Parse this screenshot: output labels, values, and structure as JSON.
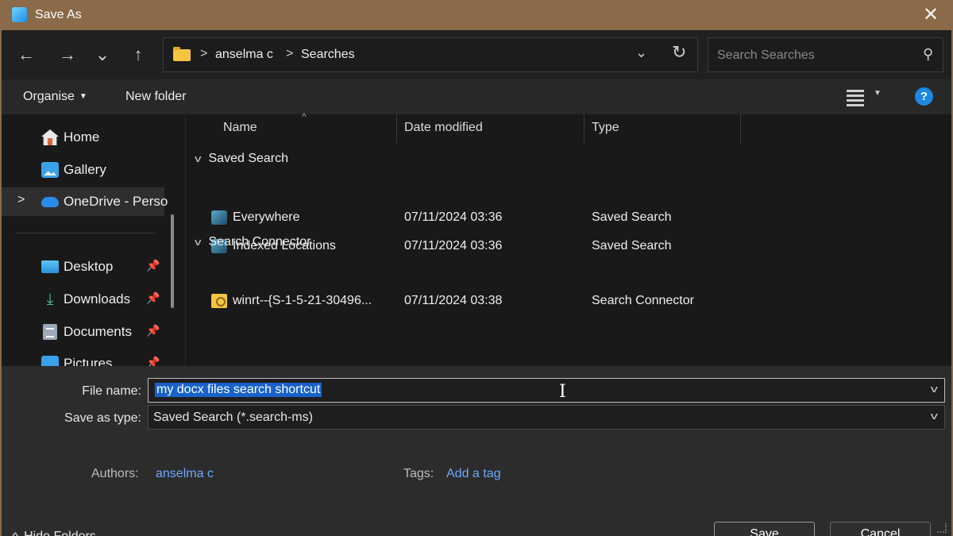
{
  "window": {
    "title": "Save As",
    "close": "✕"
  },
  "nav": {
    "back": "←",
    "forward": "→",
    "recent": "⌄",
    "up": "↑"
  },
  "address": {
    "segments": [
      "anselma c",
      "Searches"
    ],
    "separator": ">",
    "dropdown": "⌄",
    "refresh": "↻"
  },
  "search": {
    "placeholder": "Search Searches",
    "icon": "⚲"
  },
  "toolbar": {
    "organise": "Organise",
    "new_folder": "New folder",
    "help": "?"
  },
  "sidebar": {
    "items": [
      {
        "label": "Home",
        "icon": "home-icon"
      },
      {
        "label": "Gallery",
        "icon": "gallery-icon"
      },
      {
        "label": "OneDrive - Perso",
        "icon": "onedrive-icon",
        "expand": ">"
      },
      {
        "label": "Desktop",
        "icon": "desktop-icon",
        "pin": "📌"
      },
      {
        "label": "Downloads",
        "icon": "downloads-icon",
        "pin": "📌",
        "glyph": "⤓"
      },
      {
        "label": "Documents",
        "icon": "documents-icon",
        "pin": "📌"
      },
      {
        "label": "Pictures",
        "icon": "pictures-icon",
        "pin": "📌"
      }
    ]
  },
  "filelist": {
    "columns": {
      "name": "Name",
      "date": "Date modified",
      "type": "Type",
      "sort_glyph": "^"
    },
    "groups": [
      {
        "label": "Saved Search",
        "chevron": "v",
        "rows": [
          {
            "name": "Everywhere",
            "date": "07/11/2024 03:36",
            "type": "Saved Search"
          },
          {
            "name": "Indexed Locations",
            "date": "07/11/2024 03:36",
            "type": "Saved Search"
          }
        ]
      },
      {
        "label": "Search Connector",
        "chevron": "v",
        "rows": [
          {
            "name": "winrt--{S-1-5-21-30496...",
            "date": "07/11/2024 03:38",
            "type": "Search Connector"
          }
        ]
      }
    ]
  },
  "form": {
    "file_name_label": "File name:",
    "file_name_value": "my docx files search shortcut",
    "save_type_label": "Save as type:",
    "save_type_value": "Saved Search (*.search-ms)",
    "dropdown": "v",
    "cursor": "I",
    "authors_label": "Authors:",
    "authors_value": "anselma c",
    "tags_label": "Tags:",
    "tags_value": "Add a tag"
  },
  "footer": {
    "hide_folders": "Hide Folders",
    "hide_chevron": "^",
    "save": "Save",
    "cancel": "Cancel"
  },
  "colors": {
    "accent": "#1c86e0",
    "selection": "#1862c9",
    "link": "#6ea8ff",
    "title_bar": "#8a6a48"
  }
}
